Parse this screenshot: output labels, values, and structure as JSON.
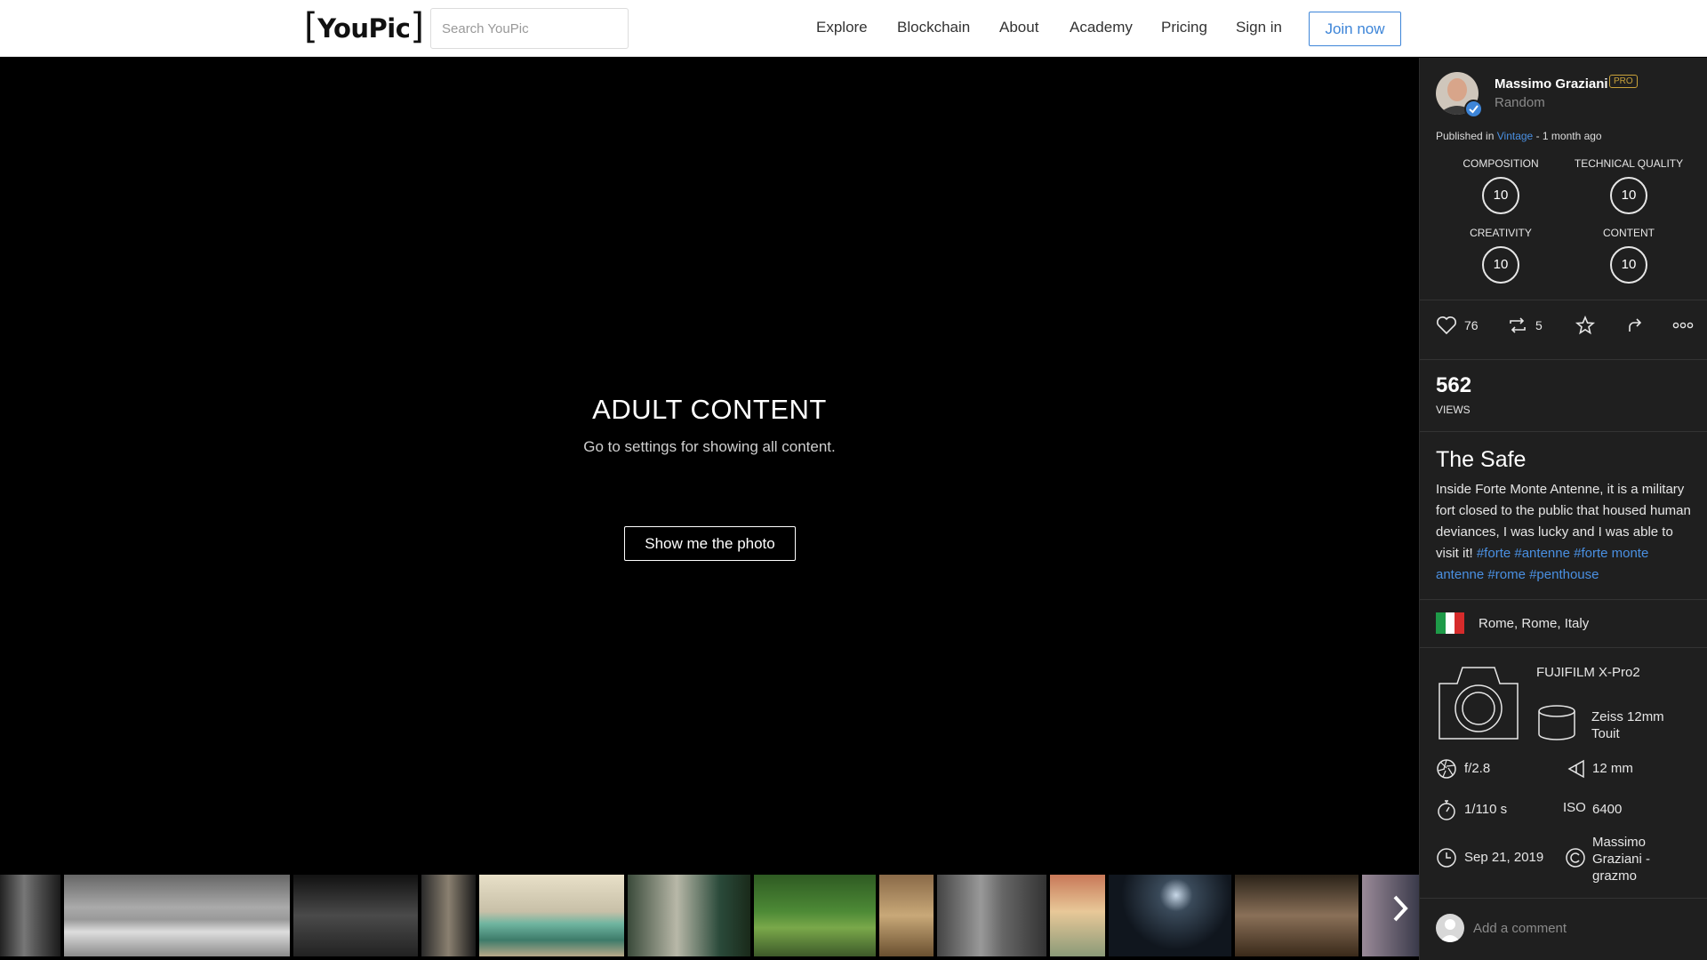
{
  "header": {
    "logo": "YouPic",
    "search_placeholder": "Search YouPic",
    "nav": [
      "Explore",
      "Blockchain",
      "About",
      "Academy",
      "Pricing",
      "Sign in"
    ],
    "join_label": "Join now"
  },
  "viewer": {
    "warning_title": "ADULT CONTENT",
    "warning_subtitle": "Go to settings for showing all content.",
    "show_button": "Show me the photo",
    "next_icon": "chevron-right-icon"
  },
  "sidebar": {
    "author_name": "Massimo Graziani",
    "pro_badge": "PRO",
    "category": "Random",
    "published_prefix": "Published in",
    "published_gallery": "Vintage",
    "published_time": "- 1 month ago",
    "scores": [
      {
        "label": "COMPOSITION",
        "value": "10"
      },
      {
        "label": "TECHNICAL QUALITY",
        "value": "10"
      },
      {
        "label": "CREATIVITY",
        "value": "10"
      },
      {
        "label": "CONTENT",
        "value": "10"
      }
    ],
    "likes": "76",
    "reposts": "5",
    "views_count": "562",
    "views_label": "VIEWS",
    "photo_title": "The Safe",
    "description": "Inside Forte Monte Antenne, it is a military fort closed to the public that housed human deviances, I was lucky and I was able to visit it!",
    "tags": "#forte #antenne #forte monte antenne #rome #penthouse",
    "location": "Rome, Rome, Italy",
    "camera": "FUJIFILM X-Pro2",
    "lens": "Zeiss 12mm Touit",
    "aperture": "f/2.8",
    "focal_length": "12 mm",
    "shutter": "1/110 s",
    "iso_label": "ISO",
    "iso": "6400",
    "date": "Sep 21, 2019",
    "copyright": "Massimo Graziani - grazmo",
    "comment_placeholder": "Add a comment",
    "colors": {
      "accent": "#3d85d8",
      "link": "#4a90e2",
      "pro": "#c9a23a"
    }
  }
}
